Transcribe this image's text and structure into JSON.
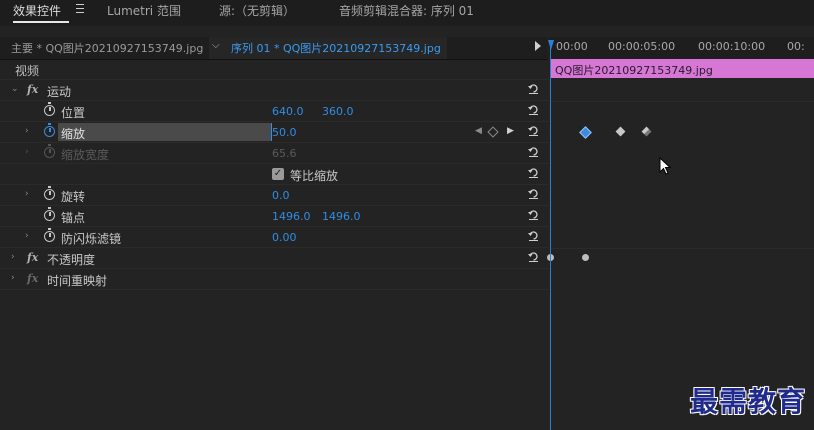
{
  "tabs": [
    {
      "label": "效果控件"
    },
    {
      "label": "Lumetri 范围"
    },
    {
      "label": "源:（无剪辑）"
    },
    {
      "label": "音频剪辑混合器: 序列 01"
    }
  ],
  "header": {
    "master_source": "主要 * QQ图片20210927153749.jpg",
    "sequence_clip": "序列 01 * QQ图片20210927153749.jpg"
  },
  "ruler": {
    "ticks": [
      "00:00",
      "00:00:05:00",
      "00:00:10:00",
      "00:"
    ]
  },
  "clip": {
    "label": "QQ图片20210927153749.jpg",
    "color": "#d677d6"
  },
  "section": {
    "label": "视频"
  },
  "effects": {
    "motion": {
      "label": "运动"
    },
    "position": {
      "label": "位置",
      "x": "640.0",
      "y": "360.0"
    },
    "scale": {
      "label": "缩放",
      "value": "50.0"
    },
    "scale_width": {
      "label": "缩放宽度",
      "value": "65.6"
    },
    "uniform_scale": {
      "label": "等比缩放",
      "checked": true
    },
    "rotation": {
      "label": "旋转",
      "value": "0.0"
    },
    "anchor": {
      "label": "锚点",
      "x": "1496.0",
      "y": "1496.0"
    },
    "antiflicker": {
      "label": "防闪烁滤镜",
      "value": "0.00"
    },
    "opacity": {
      "label": "不透明度"
    },
    "time_remap": {
      "label": "时间重映射"
    }
  },
  "watermark": {
    "text": "最需教育"
  },
  "colors": {
    "accent": "#2f8de4",
    "playhead": "#2b7fd6",
    "keyframe_selected": "#3b8be0"
  }
}
